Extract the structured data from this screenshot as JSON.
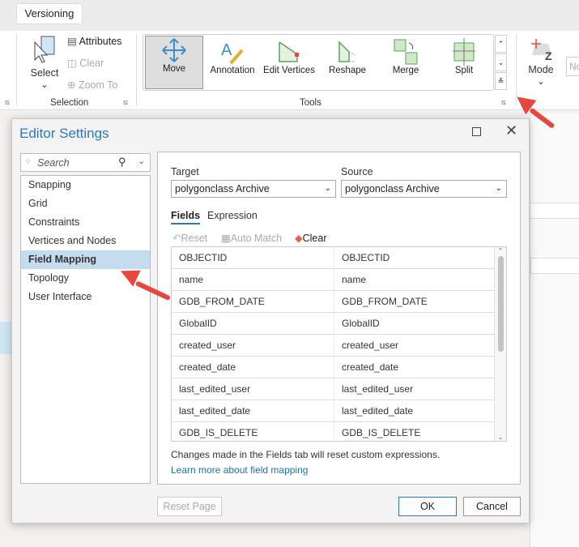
{
  "ribbon": {
    "tab": "Versioning",
    "selection": {
      "select": "Select",
      "attributes": "Attributes",
      "clear": "Clear",
      "zoom_to": "Zoom To",
      "group": "Selection"
    },
    "tools": [
      {
        "label": "Move"
      },
      {
        "label": "Annotation"
      },
      {
        "label": "Edit Vertices"
      },
      {
        "label": "Reshape"
      },
      {
        "label": "Merge"
      },
      {
        "label": "Split"
      }
    ],
    "tools_group": "Tools",
    "mode": "Mode",
    "partial_right": "No"
  },
  "dialog": {
    "title": "Editor Settings",
    "search_placeholder": "Search",
    "nav": [
      "Snapping",
      "Grid",
      "Constraints",
      "Vertices and Nodes",
      "Field Mapping",
      "Topology",
      "User Interface"
    ],
    "target_label": "Target",
    "target_value": "polygonclass Archive",
    "source_label": "Source",
    "source_value": "polygonclass Archive",
    "tabs": [
      "Fields",
      "Expression"
    ],
    "actions": {
      "reset": "Reset",
      "auto_match": "Auto Match",
      "clear": "Clear"
    },
    "rows": [
      [
        "OBJECTID",
        "OBJECTID"
      ],
      [
        "name",
        "name"
      ],
      [
        "GDB_FROM_DATE",
        "GDB_FROM_DATE"
      ],
      [
        "GlobalID",
        "GlobalID"
      ],
      [
        "created_user",
        "created_user"
      ],
      [
        "created_date",
        "created_date"
      ],
      [
        "last_edited_user",
        "last_edited_user"
      ],
      [
        "last_edited_date",
        "last_edited_date"
      ],
      [
        "GDB_IS_DELETE",
        "GDB_IS_DELETE"
      ]
    ],
    "note": "Changes made in the Fields tab will reset custom expressions.",
    "link": "Learn more about field mapping",
    "reset_page": "Reset Page",
    "ok": "OK",
    "cancel": "Cancel"
  }
}
